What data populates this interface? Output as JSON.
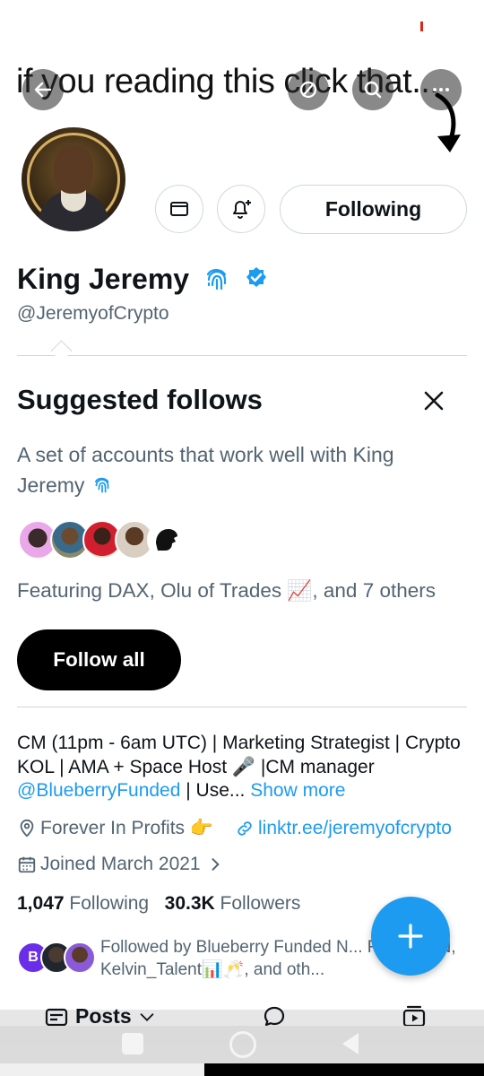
{
  "banner": {
    "overlay_text": "if you reading this click that..."
  },
  "profile": {
    "name": "King Jeremy",
    "handle": "@JeremyofCrypto",
    "following_button_label": "Following",
    "bio_part1": "CM (11pm - 6am UTC) | Marketing Strategist | Crypto KOL | AMA + Space Host ",
    "bio_part2": " |CM manager ",
    "bio_mention": "@BlueberryFunded",
    "bio_part3": " | Use...",
    "show_more": "Show more",
    "location": "Forever In Profits 👉",
    "website": "linktr.ee/jeremyofcrypto",
    "joined": "Joined March 2021",
    "following_count": "1,047",
    "following_label": "Following",
    "followers_count": "30.3K",
    "followers_label": "Followers",
    "followed_by": "Followed by Blueberry Funded N... FZNATION, Kelvin_Talent📊🥂, and oth..."
  },
  "suggested": {
    "title": "Suggested follows",
    "description": "A set of accounts that work well with King Jeremy",
    "featuring": "Featuring DAX, Olu of Trades 📈, and 7 others",
    "follow_all_label": "Follow all"
  },
  "tabs": {
    "posts_label": "Posts"
  },
  "colors": {
    "accent": "#1d9bf0",
    "text_primary": "#0f1419",
    "text_secondary": "#536471",
    "border": "#cfd9de"
  },
  "icons": [
    "back-arrow-icon",
    "slash-circle-icon",
    "search-icon",
    "more-icon",
    "mail-icon",
    "bell-plus-icon",
    "verified-badge-icon",
    "fingerprint-icon",
    "close-icon",
    "location-icon",
    "link-icon",
    "calendar-icon",
    "chevron-right-icon",
    "plus-icon",
    "posts-icon",
    "chat-icon",
    "media-icon"
  ]
}
